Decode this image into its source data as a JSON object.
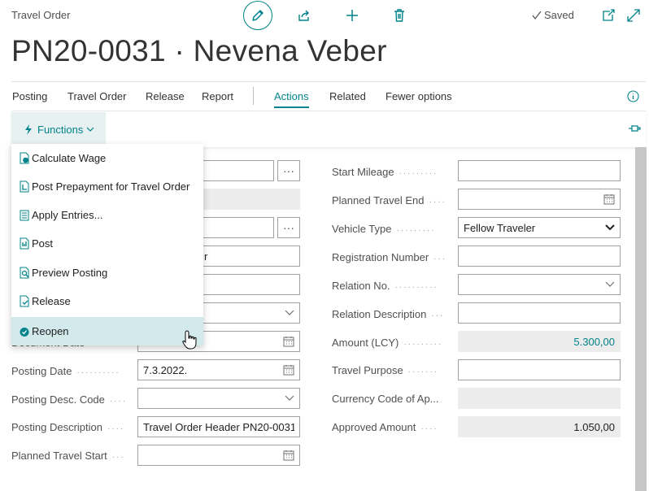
{
  "header": {
    "breadcrumb": "Travel Order",
    "saved": "Saved",
    "title": "PN20-0031 · Nevena Veber"
  },
  "action_bar": {
    "tabs": [
      "Posting",
      "Travel Order",
      "Release",
      "Report",
      "Actions",
      "Related",
      "Fewer options"
    ],
    "active_tab": "Actions",
    "functions_label": "Functions"
  },
  "menu": {
    "items": [
      "Calculate Wage",
      "Post Prepayment for Travel Order",
      "Apply Entries...",
      "Post",
      "Preview Posting",
      "Release",
      "Reopen"
    ],
    "highlighted": "Reopen"
  },
  "left_fields": {
    "document_date_label": "Document Date",
    "document_date_partial": "7.3.2022.",
    "partial_text": "r",
    "posting_date_label": "Posting Date",
    "posting_date": "7.3.2022.",
    "posting_desc_code_label": "Posting Desc. Code",
    "posting_desc_code": "",
    "posting_description_label": "Posting Description",
    "posting_description": "Travel Order Header PN20-0031",
    "planned_travel_start_label": "Planned Travel Start",
    "planned_travel_start": ""
  },
  "right_fields": {
    "start_mileage_label": "Start Mileage",
    "start_mileage": "",
    "planned_travel_end_label": "Planned Travel End",
    "planned_travel_end": "",
    "vehicle_type_label": "Vehicle Type",
    "vehicle_type": "Fellow Traveler",
    "registration_number_label": "Registration Number",
    "registration_number": "",
    "relation_no_label": "Relation No.",
    "relation_no": "",
    "relation_description_label": "Relation Description",
    "relation_description": "",
    "amount_lcy_label": "Amount (LCY)",
    "amount_lcy": "5.300,00",
    "travel_purpose_label": "Travel Purpose",
    "travel_purpose": "",
    "currency_code_label": "Currency Code of Ap...",
    "currency_code": "",
    "approved_amount_label": "Approved Amount",
    "approved_amount": "1.050,00"
  },
  "colors": {
    "accent": "#00838a",
    "menu_highlight": "#d3eaec",
    "readonly_field": "#ececec"
  },
  "icons": [
    "edit-icon",
    "share-icon",
    "add-icon",
    "delete-icon",
    "checkmark-icon",
    "open-in-new-window-icon",
    "expand-icon",
    "info-icon",
    "pin-icon",
    "lightning-icon",
    "chevron-down-icon",
    "calendar-icon",
    "ellipsis-icon",
    "pointer-cursor-icon"
  ]
}
